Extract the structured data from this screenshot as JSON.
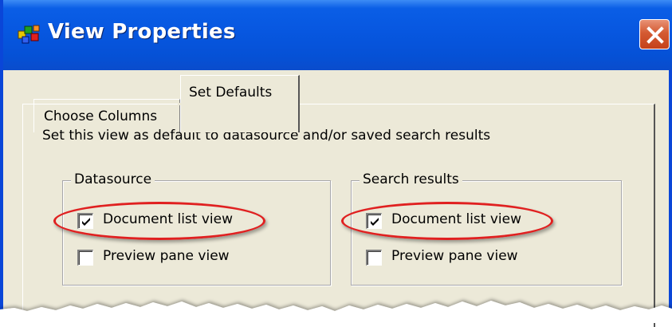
{
  "window": {
    "title": "View Properties",
    "app_icon": "view-properties-app-icon",
    "close_icon": "close-icon"
  },
  "tabs": [
    {
      "label": "Choose Columns",
      "active": false
    },
    {
      "label": "Set Defaults",
      "active": true
    }
  ],
  "set_defaults": {
    "instructions": "Set this view as default to datasource and/or saved search results",
    "datasource": {
      "legend": "Datasource",
      "options": [
        {
          "label": "Document list view",
          "checked": true
        },
        {
          "label": "Preview pane view",
          "checked": false
        }
      ]
    },
    "search_results": {
      "legend": "Search results",
      "options": [
        {
          "label": "Document list view",
          "checked": true
        },
        {
          "label": "Preview pane view",
          "checked": false
        }
      ]
    }
  },
  "colors": {
    "titlebar": "#0757e0",
    "dialog_face": "#ece9d8",
    "close_button": "#d45a32",
    "highlight": "#e02020"
  }
}
